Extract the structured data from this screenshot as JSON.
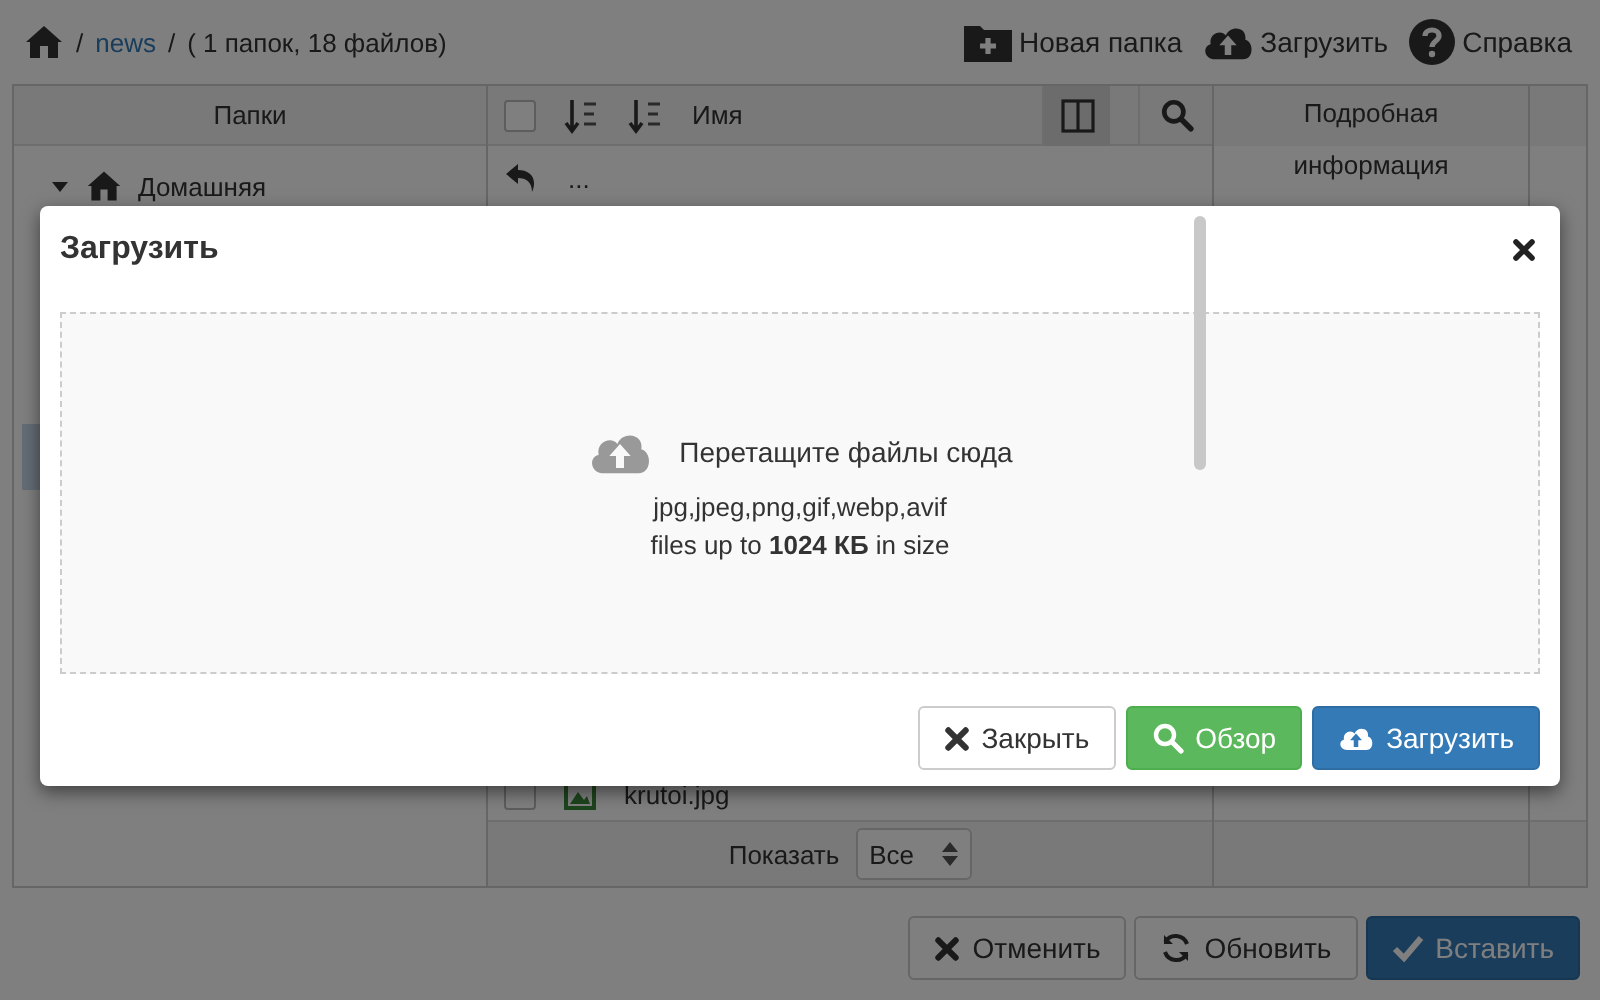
{
  "breadcrumb": [
    {
      "kind": "sep",
      "text": "/"
    },
    {
      "kind": "link",
      "text": "news"
    },
    {
      "kind": "sep",
      "text": "/"
    },
    {
      "kind": "text",
      "text": "( 1 папок, 18 файлов)"
    }
  ],
  "toolbar": [
    {
      "kind": "new-folder",
      "label": "Новая папка"
    },
    {
      "kind": "upload",
      "label": "Загрузить"
    },
    {
      "kind": "help",
      "label": "Справка"
    }
  ],
  "folders": {
    "title": "Папки",
    "items": [
      {
        "label": "Домашняя",
        "expanded": true
      }
    ]
  },
  "files": {
    "header": {
      "checked": false,
      "name_label": "Имя",
      "view_toggle_selected": true
    },
    "up_label": "...",
    "rows": [
      {
        "name": "krutoi.jpg",
        "checked": false
      }
    ],
    "show_label": "Показать",
    "show_value": "Все"
  },
  "details": {
    "title": "Подробная информация"
  },
  "footer_buttons": [
    {
      "kind": "cancel",
      "label": "Отменить"
    },
    {
      "kind": "refresh",
      "label": "Обновить"
    },
    {
      "kind": "paste",
      "label": "Вставить"
    }
  ],
  "modal": {
    "title": "Загрузить",
    "drop_text": "Перетащите файлы сюда",
    "types": "jpg,jpeg,png,gif,webp,avif",
    "limit": "files up to **1024 КБ** in size",
    "buttons": [
      {
        "kind": "close",
        "label": "Закрыть"
      },
      {
        "kind": "browse",
        "label": "Обзор"
      },
      {
        "kind": "upload",
        "label": "Загрузить"
      }
    ]
  }
}
